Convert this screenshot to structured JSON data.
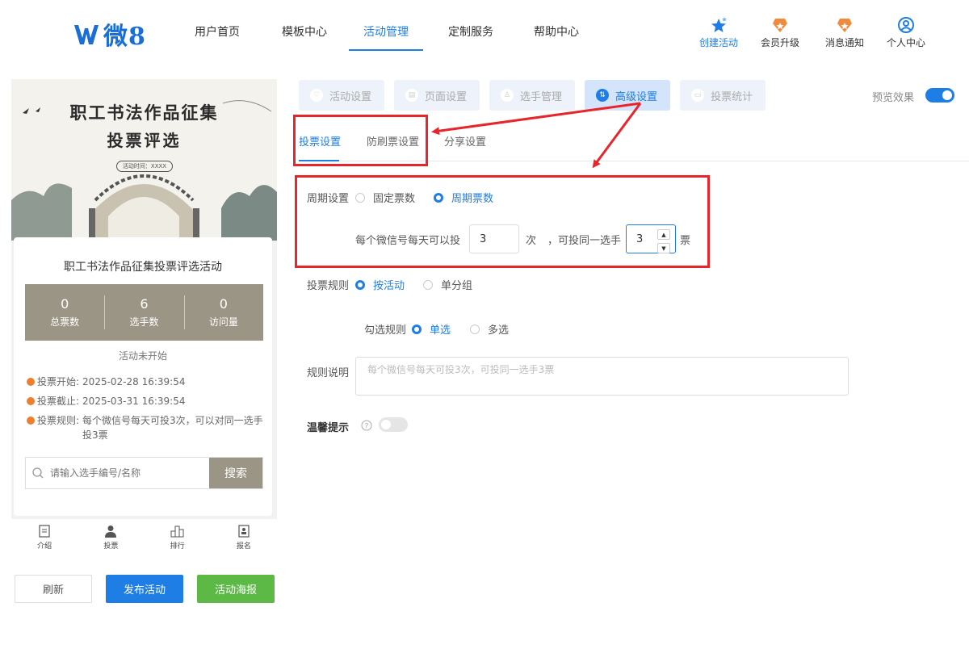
{
  "brand": {
    "logo_text": "微8",
    "accent": "#1e7ee6"
  },
  "nav": [
    {
      "label": "用户首页",
      "active": false
    },
    {
      "label": "模板中心",
      "active": false
    },
    {
      "label": "活动管理",
      "active": true
    },
    {
      "label": "定制服务",
      "active": false
    },
    {
      "label": "帮助中心",
      "active": false
    }
  ],
  "quick_links": [
    {
      "label": "创建活动",
      "icon": "star-icon"
    },
    {
      "label": "会员升级",
      "icon": "badge-icon"
    },
    {
      "label": "消息通知",
      "icon": "bell-badge-icon"
    },
    {
      "label": "个人中心",
      "icon": "user-icon"
    }
  ],
  "preview": {
    "banner_title_line1": "职工书法作品征集",
    "banner_title_line2": "投票评选",
    "banner_time": "活动时间：XXXX",
    "activity_title": "职工书法作品征集投票评选活动",
    "stats": [
      {
        "value": "0",
        "label": "总票数"
      },
      {
        "value": "6",
        "label": "选手数"
      },
      {
        "value": "0",
        "label": "访问量"
      }
    ],
    "status": "活动未开始",
    "info": [
      {
        "label": "投票开始:",
        "value": "2025-02-28 16:39:54"
      },
      {
        "label": "投票截止:",
        "value": "2025-03-31 16:39:54"
      },
      {
        "label": "投票规则:",
        "value": "每个微信号每天可投3次，可以对同一选手投3票"
      }
    ],
    "search_placeholder": "请输入选手编号/名称",
    "search_button": "搜索",
    "tabbar": [
      {
        "label": "介绍",
        "icon": "document-icon"
      },
      {
        "label": "投票",
        "icon": "person-icon"
      },
      {
        "label": "排行",
        "icon": "ranking-icon"
      },
      {
        "label": "报名",
        "icon": "signup-icon"
      }
    ]
  },
  "buttons": {
    "refresh": "刷新",
    "publish": "发布活动",
    "poster": "活动海报"
  },
  "top_tabs": [
    {
      "label": "活动设置",
      "icon": "heart-icon",
      "active": false
    },
    {
      "label": "页面设置",
      "icon": "page-icon",
      "active": false
    },
    {
      "label": "选手管理",
      "icon": "people-icon",
      "active": false
    },
    {
      "label": "高级设置",
      "icon": "sliders-icon",
      "active": true
    },
    {
      "label": "投票统计",
      "icon": "stats-icon",
      "active": false
    }
  ],
  "preview_toggle": {
    "label": "预览效果",
    "on": true
  },
  "sub_tabs": [
    {
      "label": "投票设置",
      "active": true
    },
    {
      "label": "防刷票设置",
      "active": false
    },
    {
      "label": "分享设置",
      "active": false
    }
  ],
  "form": {
    "cycle_label": "周期设置",
    "cycle_options": [
      {
        "label": "固定票数",
        "selected": false
      },
      {
        "label": "周期票数",
        "selected": true
      }
    ],
    "per_day_prefix": "每个微信号每天可以投",
    "per_day_value": "3",
    "per_day_unit": "次",
    "same_player_prefix": "，可投同一选手",
    "same_player_value": "3",
    "same_player_unit": "票",
    "rule_label": "投票规则",
    "rule_options": [
      {
        "label": "按活动",
        "selected": true
      },
      {
        "label": "单分组",
        "selected": false
      }
    ],
    "check_label": "勾选规则",
    "check_options": [
      {
        "label": "单选",
        "selected": true
      },
      {
        "label": "多选",
        "selected": false
      }
    ],
    "desc_label": "规则说明",
    "desc_placeholder": "每个微信号每天可投3次，可投同一选手3票",
    "tip_label": "温馨提示",
    "tip_on": false
  },
  "annotation_color": "#e8252a"
}
